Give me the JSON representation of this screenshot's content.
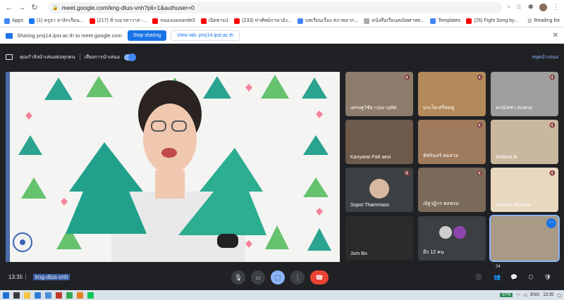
{
  "browser": {
    "url": "meet.google.com/kng-dtus-vnh?pli=1&authuser=0",
    "bookmarks": [
      {
        "label": "Apps",
        "color": "#4285f4"
      },
      {
        "label": "(1) ครูจา ลาลิกเรียน...",
        "color": "#1877f2"
      },
      {
        "label": "(217) ข้าแมวทาวาส -...",
        "color": "#ff0000"
      },
      {
        "label": "หนองแผงsmile3",
        "color": "#ff0000"
      },
      {
        "label": "เปิดหาม1",
        "color": "#ff0000"
      },
      {
        "label": "(233) ห่าศัพย์ภาษาอัง...",
        "color": "#ff0000"
      },
      {
        "label": "บทเรียนเรื่อง สภาพอาก...",
        "color": "#4285f4"
      },
      {
        "label": "หนังสือเรียนคณิตศาสต...",
        "color": "#aaaaaa"
      },
      {
        "label": "Templates",
        "color": "#4285f4"
      },
      {
        "label": "(26) Fight Song by...",
        "color": "#ff0000"
      }
    ],
    "reading_list": "Reading list"
  },
  "sharebar": {
    "text": "Sharing proj14.ipst.ac.th to meet.google.com",
    "stop_label": "Stop sharing",
    "view_label": "View tab: proj14.ipst.ac.th"
  },
  "presenting": {
    "label": "คุณกำลังนำเสนอต่อทุกคน",
    "option": "เสียงการนำเสนอ",
    "stop": "หยุดนำเสนอ"
  },
  "participants": [
    {
      "name": "เศรษฐวิชัย กรุณาอุทิศ",
      "muted": true,
      "bg": "#8d7b6b"
    },
    {
      "name": "ประไพ ศรีชมพู",
      "muted": true,
      "bg": "#b48a5a"
    },
    {
      "name": "พรณิชชา สมพรม",
      "muted": true,
      "bg": "#9e9e9e"
    },
    {
      "name": "Kanyarat Patt aesi",
      "muted": false,
      "bg": "#6d5a4a"
    },
    {
      "name": "พัชรินทร์ คมสาย",
      "muted": true,
      "bg": "#a07a5c"
    },
    {
      "name": "thidarat.tk",
      "muted": true,
      "bg": "#c9b89e"
    },
    {
      "name": "Supot Thammaso",
      "muted": true,
      "bg": "#3c4043"
    },
    {
      "name": "ณัฐวฏิกร พลพรม",
      "muted": true,
      "bg": "#7a6a5a"
    },
    {
      "name": "Anucha Pesalai",
      "muted": true,
      "bg": "#e8d8c0"
    },
    {
      "name": "Jum Bo",
      "muted": false,
      "bg": "#2b2b2b"
    },
    {
      "name": "อีก 12 คน",
      "muted": false,
      "bg": "#3c4043"
    },
    {
      "name": "",
      "muted": false,
      "bg": "#a99a85"
    }
  ],
  "bottom": {
    "time": "13:35",
    "meeting_code": "kng-dtus-vnh",
    "participant_count": "24"
  },
  "taskbar": {
    "battery": "97%",
    "lang": "ENG",
    "time": "13:35"
  },
  "colors": {
    "meet_bg": "#202124",
    "accent": "#8ab4f8",
    "end_call": "#ea4335",
    "share_blue": "#1a73e8"
  }
}
